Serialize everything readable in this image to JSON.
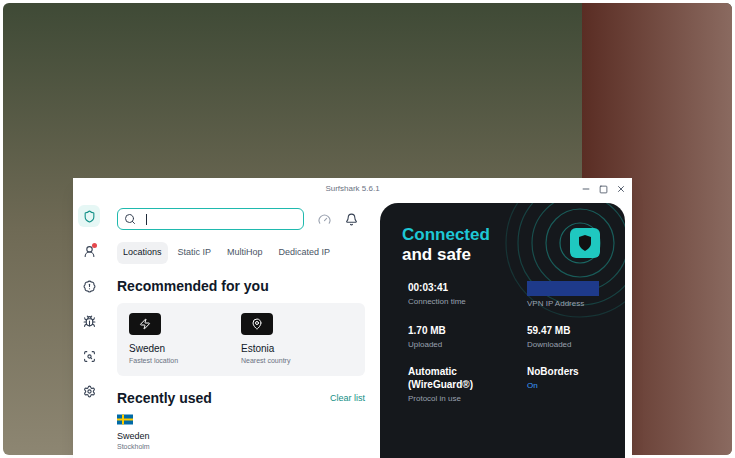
{
  "window": {
    "title": "Surfshark 5.6.1"
  },
  "sidebar": {
    "items": [
      {
        "selected": true,
        "badge": false
      },
      {
        "selected": false,
        "badge": true
      },
      {
        "selected": false,
        "badge": false
      },
      {
        "selected": false,
        "badge": false
      },
      {
        "selected": false,
        "badge": false
      },
      {
        "selected": false,
        "badge": false
      }
    ]
  },
  "search": {
    "value": "",
    "focused": true
  },
  "tabs": [
    {
      "label": "Locations",
      "selected": true
    },
    {
      "label": "Static IP",
      "selected": false
    },
    {
      "label": "MultiHop",
      "selected": false
    },
    {
      "label": "Dedicated IP",
      "selected": false
    }
  ],
  "recommended": {
    "title": "Recommended for you",
    "items": [
      {
        "name": "Sweden",
        "caption": "Fastest location"
      },
      {
        "name": "Estonia",
        "caption": "Nearest country"
      }
    ]
  },
  "recent": {
    "title": "Recently used",
    "action": "Clear list",
    "items": [
      {
        "country": "Sweden",
        "city": "Stockholm"
      }
    ]
  },
  "status": {
    "connected": true,
    "title": "Connected",
    "subtitle": "and safe"
  },
  "stats": [
    {
      "kind": "stat",
      "value": "00:03:41",
      "label": "Connection time"
    },
    {
      "kind": "redacted",
      "value": "",
      "label": "VPN IP Address"
    },
    {
      "kind": "stat",
      "value": "1.70 MB",
      "label": "Uploaded"
    },
    {
      "kind": "stat",
      "value": "59.47 MB",
      "label": "Downloaded"
    },
    {
      "kind": "stat",
      "value": "Automatic (WireGuard®)",
      "label": "Protocol in use"
    },
    {
      "kind": "toggle",
      "value": "On",
      "label": "NoBorders",
      "on": true
    }
  ]
}
